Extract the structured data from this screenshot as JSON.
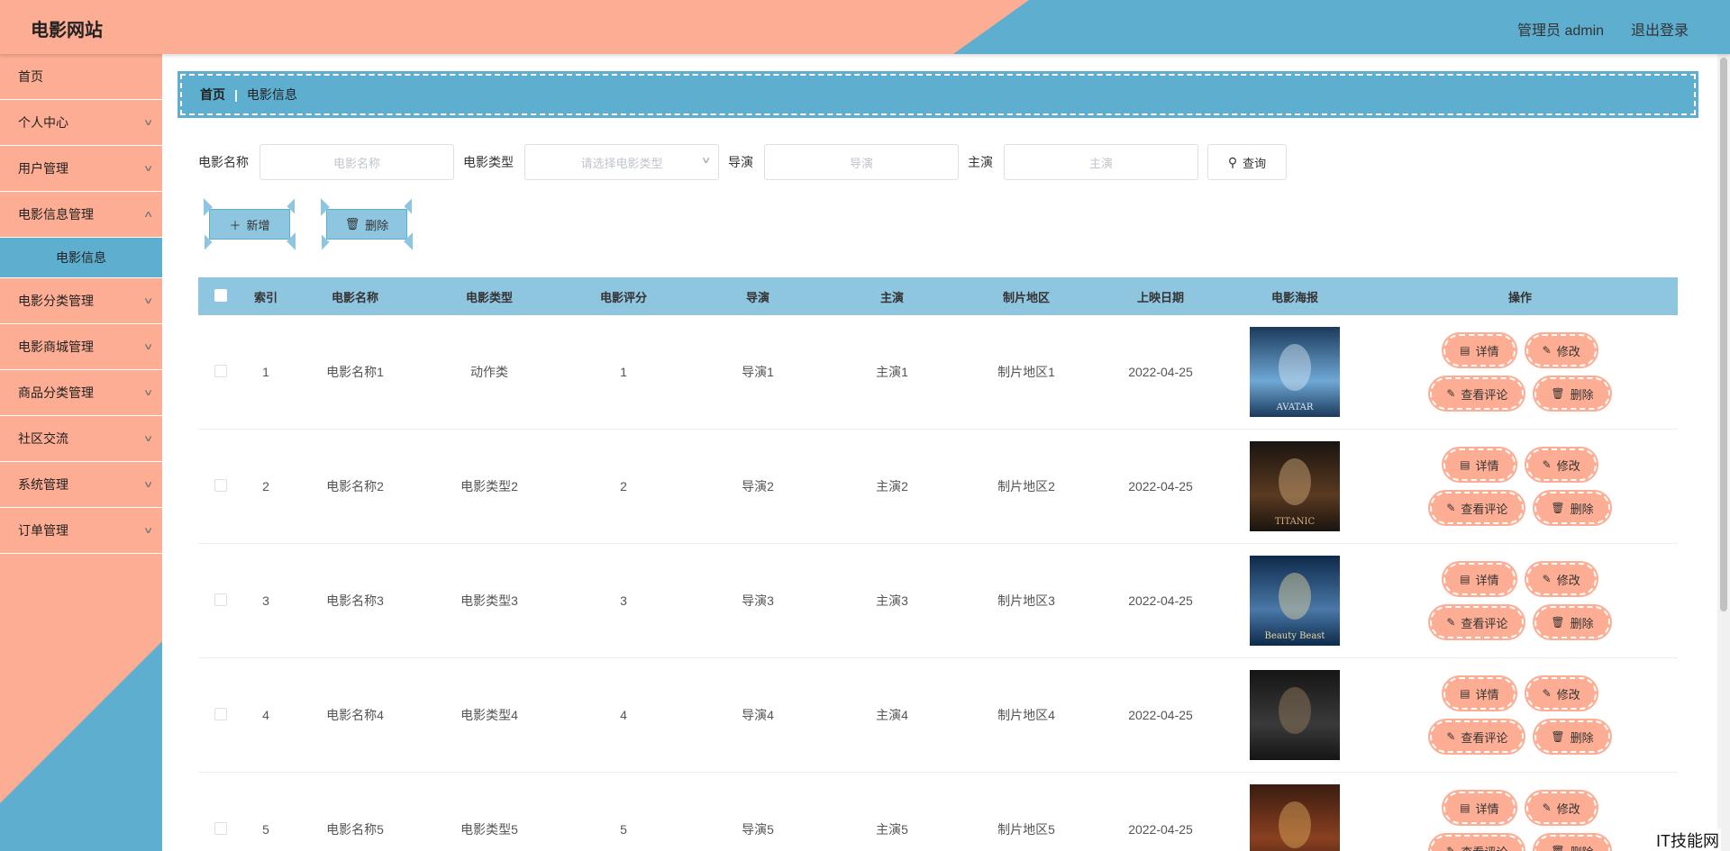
{
  "header": {
    "logo": "电影网站",
    "user": "管理员 admin",
    "logout": "退出登录"
  },
  "sidebar": {
    "items": [
      {
        "label": "首页",
        "chevron": false
      },
      {
        "label": "个人中心",
        "chevron": true
      },
      {
        "label": "用户管理",
        "chevron": true
      },
      {
        "label": "电影信息管理",
        "chevron": true
      }
    ],
    "sub_item": "电影信息",
    "items_after": [
      {
        "label": "电影分类管理"
      },
      {
        "label": "电影商城管理"
      },
      {
        "label": "商品分类管理"
      },
      {
        "label": "社区交流"
      },
      {
        "label": "系统管理"
      },
      {
        "label": "订单管理"
      }
    ]
  },
  "breadcrumb": {
    "home": "首页",
    "separator": "|",
    "current": "电影信息"
  },
  "search": {
    "name_label": "电影名称",
    "name_placeholder": "电影名称",
    "type_label": "电影类型",
    "type_placeholder": "请选择电影类型",
    "director_label": "导演",
    "director_placeholder": "导演",
    "actor_label": "主演",
    "actor_placeholder": "主演",
    "query_button": "查询"
  },
  "actions": {
    "add": "新增",
    "delete": "删除"
  },
  "table": {
    "headers": [
      "索引",
      "电影名称",
      "电影类型",
      "电影评分",
      "导演",
      "主演",
      "制片地区",
      "上映日期",
      "电影海报",
      "操作"
    ],
    "rows": [
      {
        "index": "1",
        "name": "电影名称1",
        "type": "动作类",
        "score": "1",
        "director": "导演1",
        "actor": "主演1",
        "region": "制片地区1",
        "date": "2022-04-25",
        "poster": "AVATAR"
      },
      {
        "index": "2",
        "name": "电影名称2",
        "type": "电影类型2",
        "score": "2",
        "director": "导演2",
        "actor": "主演2",
        "region": "制片地区2",
        "date": "2022-04-25",
        "poster": "TITANIC"
      },
      {
        "index": "3",
        "name": "电影名称3",
        "type": "电影类型3",
        "score": "3",
        "director": "导演3",
        "actor": "主演3",
        "region": "制片地区3",
        "date": "2022-04-25",
        "poster": "Beauty Beast"
      },
      {
        "index": "4",
        "name": "电影名称4",
        "type": "电影类型4",
        "score": "4",
        "director": "导演4",
        "actor": "主演4",
        "region": "制片地区4",
        "date": "2022-04-25",
        "poster": ""
      },
      {
        "index": "5",
        "name": "电影名称5",
        "type": "电影类型5",
        "score": "5",
        "director": "导演5",
        "actor": "主演5",
        "region": "制片地区5",
        "date": "2022-04-25",
        "poster": ""
      }
    ],
    "ops": {
      "detail": "详情",
      "edit": "修改",
      "review": "查看评论",
      "delete": "删除"
    }
  },
  "watermark": "IT技能网",
  "colors": {
    "peach": "#fdad93",
    "blue": "#5eaecf",
    "light_blue": "#8ec5df"
  }
}
